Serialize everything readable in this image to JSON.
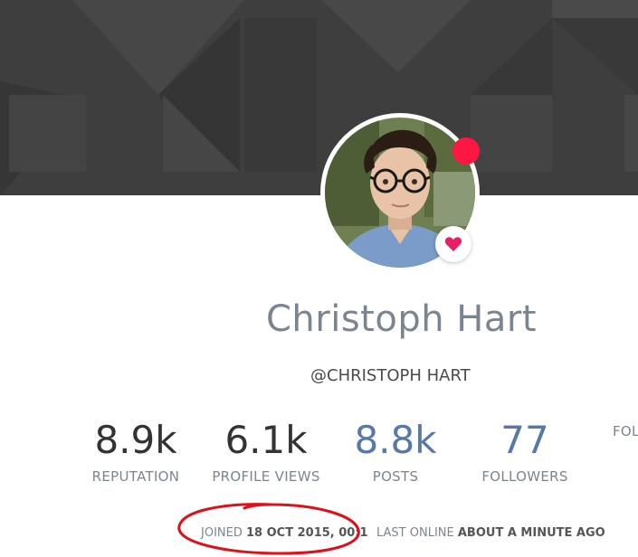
{
  "profile": {
    "fullname": "Christoph Hart",
    "username": "@CHRISTOPH HART",
    "status_color": "#ff1744",
    "heart_color": "#e91e63"
  },
  "stats": [
    {
      "value": "8.9k",
      "label": "REPUTATION"
    },
    {
      "value": "6.1k",
      "label": "PROFILE VIEWS"
    },
    {
      "value": "8.8k",
      "label": "POSTS"
    },
    {
      "value": "77",
      "label": "FOLLOWERS"
    },
    {
      "value": "",
      "label": "FOL"
    }
  ],
  "meta": {
    "joined_label": "JOINED",
    "joined_value": "18 OCT 2015, 00:1",
    "last_online_label": "LAST ONLINE",
    "last_online_value": "ABOUT A MINUTE AGO"
  },
  "colors": {
    "cover_bg": "#3e3e3e",
    "link_blue": "#5878a8",
    "annotation_red": "#e0101a"
  }
}
